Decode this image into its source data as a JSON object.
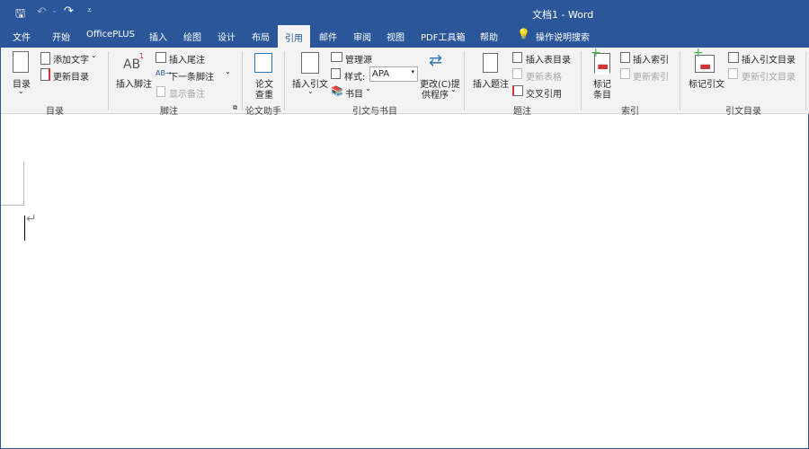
{
  "title": "文档1  -  Word",
  "quick_access": {
    "save": "save-icon",
    "undo": "undo-icon",
    "redo": "redo-icon",
    "customize": "customize-icon"
  },
  "tabs": [
    "文件",
    "开始",
    "OfficePLUS",
    "插入",
    "绘图",
    "设计",
    "布局",
    "引用",
    "邮件",
    "审阅",
    "视图",
    "PDF工具箱",
    "帮助"
  ],
  "active_tab": "引用",
  "tell_me": "操作说明搜索",
  "groups": {
    "toc": {
      "label": "目录",
      "toc_button": "目录",
      "add_text": "添加文字",
      "update_toc": "更新目录"
    },
    "footnotes": {
      "label": "脚注",
      "insert_footnote": "插入脚注",
      "insert_endnote": "插入尾注",
      "next_footnote": "下一条脚注",
      "show_notes": "显示备注",
      "footnote_icon_text": "AB",
      "footnote_sup": "1"
    },
    "paper": {
      "label": "论文助手",
      "check": "论文查重",
      "check_l1": "论文",
      "check_l2": "查重"
    },
    "citations": {
      "label": "引文与书目",
      "insert_citation": "插入引文",
      "manage_sources": "管理源",
      "style_label": "样式:",
      "style_value": "APA",
      "bibliography": "书目",
      "change_provider_l1": "更改(C)提",
      "change_provider_l2": "供程序"
    },
    "captions": {
      "label": "题注",
      "insert_caption": "插入题注",
      "insert_table_of_figures": "插入表目录",
      "update_table": "更新表格",
      "cross_reference": "交叉引用"
    },
    "index": {
      "label": "索引",
      "mark_entry_l1": "标记",
      "mark_entry_l2": "条目",
      "insert_index": "插入索引",
      "update_index": "更新索引"
    },
    "toa": {
      "label": "引文目录",
      "mark_citation": "标记引文",
      "insert_toa": "插入引文目录",
      "update_toa": "更新引文目录"
    }
  }
}
